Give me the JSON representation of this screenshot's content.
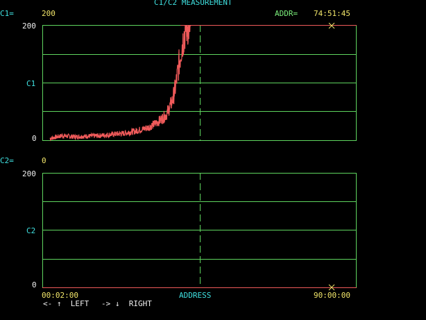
{
  "title": "C1/C2 MEASUREMENT",
  "c1": {
    "label": "C1=",
    "value": "200",
    "axis_top": "200",
    "axis_mid": "C1",
    "axis_bottom": "0"
  },
  "c2": {
    "label": "C2=",
    "value": "0",
    "axis_top": "200",
    "axis_mid": "C2",
    "axis_bottom": "0"
  },
  "addr": {
    "label": "ADDR=",
    "value": "74:51:45"
  },
  "time_start": "00:02:00",
  "time_end": "90:00:00",
  "x_label": "ADDRESS",
  "nav": {
    "left": "<- ↑  LEFT",
    "right": "-> ↓  RIGHT"
  },
  "colors": {
    "grid": "#5fd65f",
    "trace": "#f05a5a",
    "cursor": "#f2e66a",
    "label": "#3fe0e0",
    "value": "#f2e66a"
  },
  "chart_data": [
    {
      "type": "line",
      "ylabel": "C1",
      "ylim": [
        0,
        200
      ],
      "x": [
        0,
        4,
        8,
        12,
        16,
        20,
        24,
        28,
        32,
        34,
        36,
        38,
        40,
        41,
        42,
        43,
        44,
        44.5,
        45,
        46
      ],
      "values": [
        3,
        8,
        6,
        7,
        8,
        10,
        12,
        16,
        22,
        28,
        35,
        45,
        70,
        95,
        130,
        165,
        190,
        200,
        200,
        200
      ]
    },
    {
      "type": "line",
      "ylabel": "C2",
      "ylim": [
        0,
        200
      ],
      "x": [
        0,
        100
      ],
      "values": [
        0,
        0
      ]
    }
  ]
}
